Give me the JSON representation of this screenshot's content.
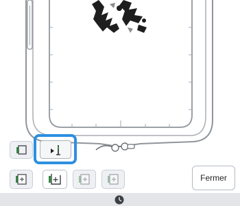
{
  "screen": {
    "close_label": "Fermer"
  },
  "icons": {
    "embroidery_design": "embroidery-design-image",
    "frame_toggle": "frame-outline-icon",
    "trace": "trace-play-icon",
    "row_1": "frame-plus-icon",
    "row_2": "frame-plus-icon",
    "row_3": "frame-plus-icon",
    "row_4": "frame-plus-icon",
    "bottom_bar": "clock-icon"
  },
  "state": {
    "trace_button_highlighted": true,
    "row_button_selected": 2,
    "row_buttons_disabled": [
      3,
      4
    ]
  },
  "colors": {
    "highlight": "#2d8fe0",
    "frame_line": "#8f949b",
    "button_bg": "#eef0f4",
    "bottom_bar": "#e3e5e8"
  }
}
